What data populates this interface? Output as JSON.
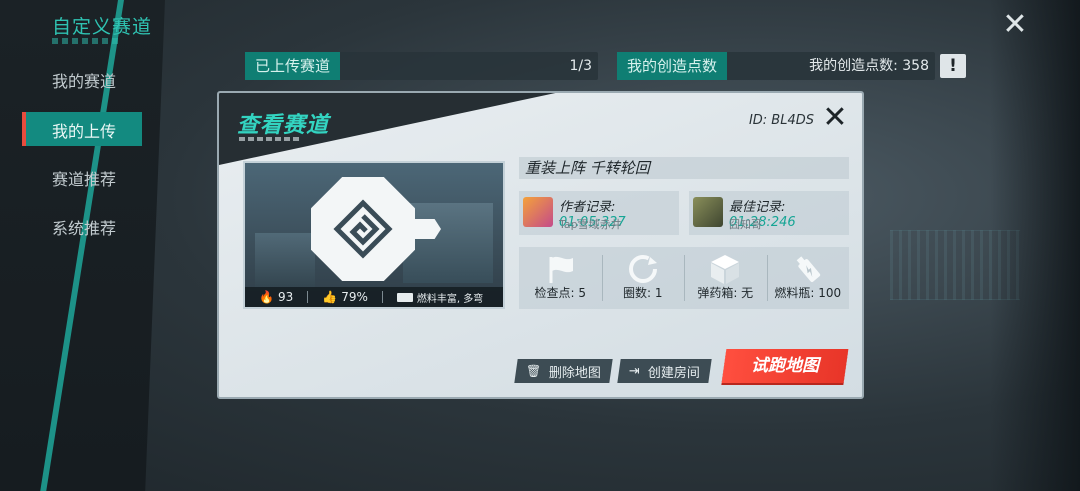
{
  "sidebar": {
    "title": "自定义赛道",
    "items": [
      {
        "label": "我的赛道"
      },
      {
        "label": "我的上传"
      },
      {
        "label": "赛道推荐"
      },
      {
        "label": "系统推荐"
      }
    ],
    "active_index": 1
  },
  "header": {
    "uploaded_tag": "已上传赛道",
    "uploaded_count": "1/3",
    "create_points_tag": "我的创造点数",
    "create_points_value": "我的创造点数: 358",
    "info_icon": "exclamation-icon"
  },
  "modal": {
    "title": "查看赛道",
    "id_label": "ID: BL4DS",
    "track_name": "重装上阵  千转轮回",
    "thumbnail": {
      "heat": "93",
      "likes": "79%",
      "fuel_note": "燃料丰富, 多弯"
    },
    "author_record": {
      "label": "作者记录:",
      "time": "01:05:327",
      "user": "Tap雪域赤井"
    },
    "best_record": {
      "label": "最佳记录:",
      "time": "01:28:246",
      "user": "囧知哥"
    },
    "stats": [
      {
        "icon": "flag-icon",
        "label": "检查点: 5"
      },
      {
        "icon": "lap-icon",
        "label": "圈数: 1"
      },
      {
        "icon": "ammo-box-icon",
        "label": "弹药箱: 无"
      },
      {
        "icon": "fuel-bottle-icon",
        "label": "燃料瓶: 100"
      }
    ],
    "buttons": {
      "delete": "删除地图",
      "create_room": "创建房间",
      "test_run": "试跑地图"
    }
  },
  "colors": {
    "accent": "#2fc3b2",
    "run_button": "#ff4f3f",
    "sidebar_active": "#138a80"
  }
}
